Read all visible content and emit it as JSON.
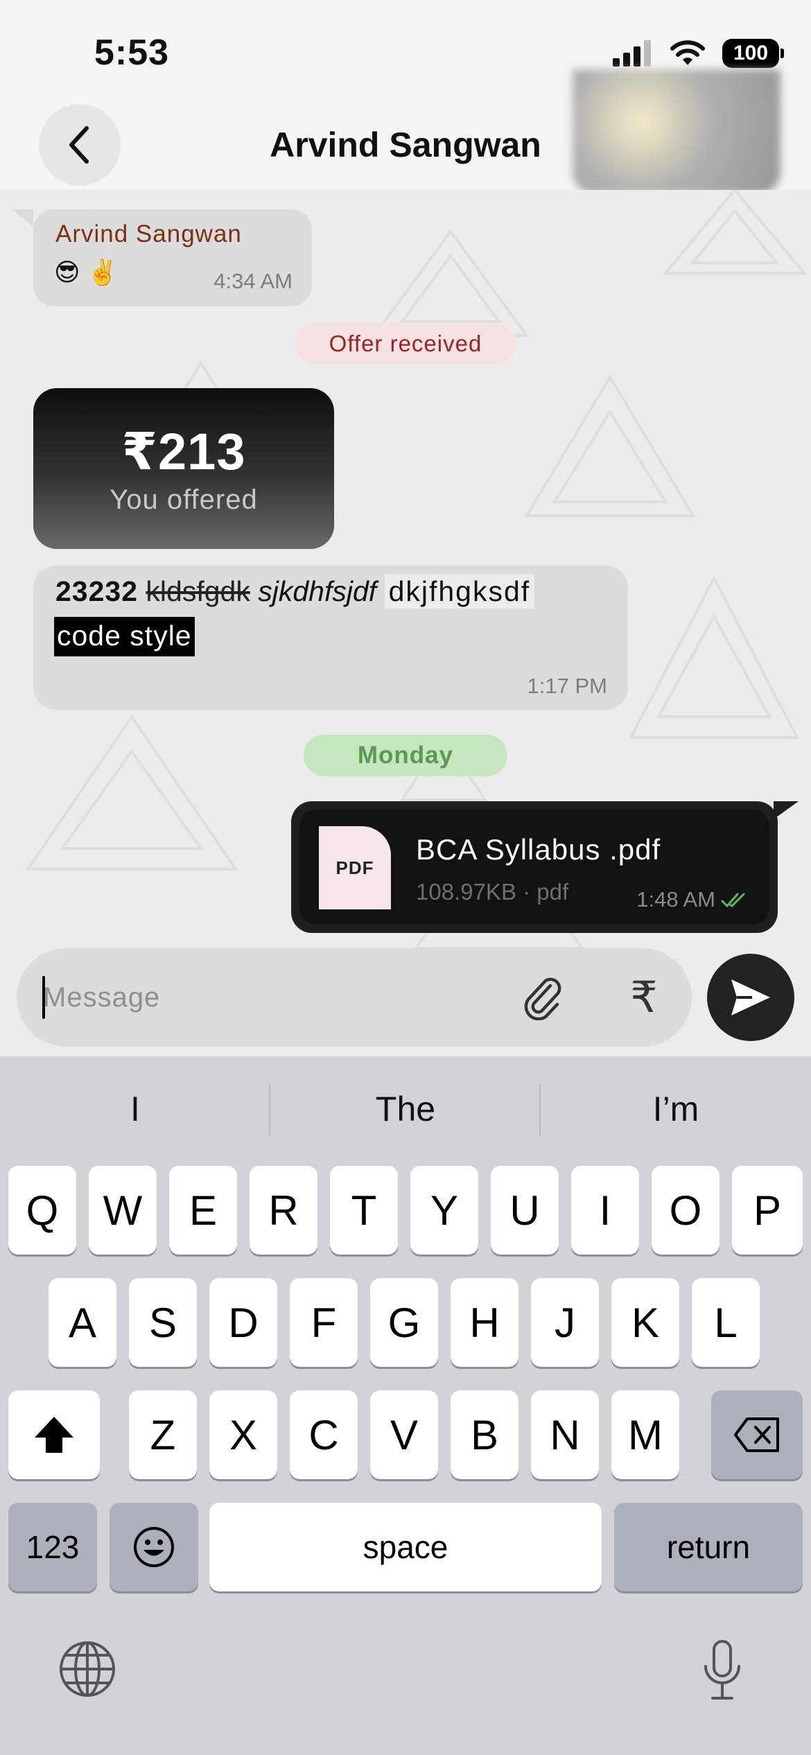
{
  "status_bar": {
    "time": "5:53",
    "battery": "100"
  },
  "header": {
    "title": "Arvind Sangwan"
  },
  "messages": {
    "incoming": {
      "sender": "Arvind Sangwan",
      "emojis": "😎 ✌️",
      "time": "4:34 AM"
    },
    "offer_notice": "Offer received",
    "offer_card": {
      "amount": "₹213",
      "label": "You offered"
    },
    "rich_text": {
      "bold": "23232",
      "strike": "kldsfgdk",
      "italic": "sjkdhfsjdf",
      "code_inline": "dkjfhgksdf",
      "code_block": "code style",
      "time": "1:17 PM"
    },
    "day_separator": "Monday",
    "file": {
      "icon_label": "PDF",
      "name": "BCA Syllabus .pdf",
      "meta": "108.97KB · pdf",
      "time": "1:48 AM",
      "status": "read"
    }
  },
  "composer": {
    "placeholder": "Message",
    "value": "",
    "currency_symbol": "₹"
  },
  "keyboard": {
    "suggestions": [
      "I",
      "The",
      "I’m"
    ],
    "row1": [
      "Q",
      "W",
      "E",
      "R",
      "T",
      "Y",
      "U",
      "I",
      "O",
      "P"
    ],
    "row2": [
      "A",
      "S",
      "D",
      "F",
      "G",
      "H",
      "J",
      "K",
      "L"
    ],
    "row3": [
      "Z",
      "X",
      "C",
      "V",
      "B",
      "N",
      "M"
    ],
    "numbers_key": "123",
    "space_key": "space",
    "return_key": "return"
  },
  "icons": {
    "back": "chevron-left-icon",
    "attach": "paperclip-icon",
    "send": "send-icon",
    "shift": "shift-icon",
    "delete": "backspace-icon",
    "emoji": "emoji-icon",
    "globe": "globe-icon",
    "mic": "microphone-icon"
  },
  "colors": {
    "sender_name": "#7a2f17",
    "offer_notice_bg": "#f6e2e2",
    "offer_notice_text": "#9a2424",
    "day_pill_bg": "#c4e7bf",
    "day_pill_text": "#5a9a55",
    "read_ticks": "#5cb85c",
    "send_button": "#222222"
  }
}
